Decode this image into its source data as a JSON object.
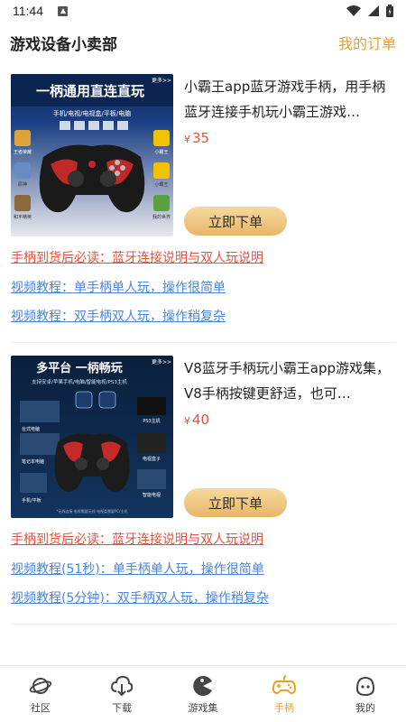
{
  "status_bar": {
    "time": "11:44"
  },
  "header": {
    "title": "游戏设备小卖部",
    "orders_label": "我的订单"
  },
  "products": [
    {
      "name": "小霸王app蓝牙游戏手柄，用手柄蓝牙连接手机玩小霸王游戏…",
      "price_symbol": "¥",
      "price": "35",
      "buy_label": "立即下单",
      "thumb": {
        "banner": "一柄通用直连直玩",
        "subtitle": "手机/电视/电视盒/平板/电脑",
        "more": "更多>>",
        "tags_left": [
          "王者荣耀",
          "原神",
          "和平精英"
        ],
        "tags_right": [
          "小霸王",
          "小霸王",
          "我的世界"
        ]
      },
      "links": [
        {
          "text": "手柄到货后必读：蓝牙连接说明与双人玩说明",
          "color": "red"
        },
        {
          "text": "视频教程：单手柄单人玩，操作很简单",
          "color": "blue"
        },
        {
          "text": "视频教程：双手柄双人玩，操作稍复杂",
          "color": "blue"
        }
      ]
    },
    {
      "name": "V8蓝牙手柄玩小霸王app游戏集，V8手柄按键更舒适，也可…",
      "price_symbol": "¥",
      "price": "40",
      "buy_label": "立即下单",
      "thumb": {
        "banner": "多平台 一柄畅玩",
        "subtitle": "支持安卓/苹果手机/电脑/智能电视/PS3主机",
        "more": "更多>>",
        "tags_left": [
          "台式电脑",
          "笔记本电脑",
          "手机/平板"
        ],
        "tags_right": [
          "PS3主机",
          "电视盒子",
          "智能电视"
        ],
        "footnote": "*无线连接 电视需要无线 电视类需要PC/主机"
      },
      "links": [
        {
          "text": "手柄到货后必读：蓝牙连接说明与双人玩说明",
          "color": "red"
        },
        {
          "text": "视频教程(51秒)：单手柄单人玩，操作很简单",
          "color": "blue"
        },
        {
          "text": "视频教程(5分钟)：双手柄双人玩，操作稍复杂",
          "color": "blue"
        }
      ]
    }
  ],
  "tabbar": [
    {
      "label": "社区",
      "icon": "planet-icon",
      "active": false
    },
    {
      "label": "下载",
      "icon": "cloud-download-icon",
      "active": false
    },
    {
      "label": "游戏集",
      "icon": "pacman-icon",
      "active": false
    },
    {
      "label": "手柄",
      "icon": "gamepad-icon",
      "active": true
    },
    {
      "label": "我的",
      "icon": "profile-face-icon",
      "active": false
    }
  ],
  "colors": {
    "accent": "#e0a03a",
    "link_red": "#e9503c",
    "link_blue": "#4a86d8",
    "tab_active": "#f0a020"
  }
}
